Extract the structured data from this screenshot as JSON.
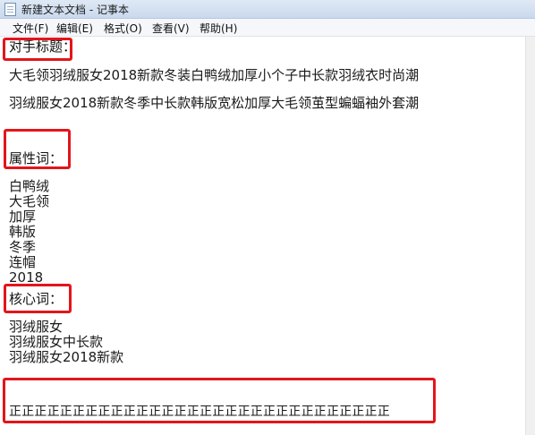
{
  "window": {
    "title": "新建文本文档 - 记事本"
  },
  "menu": {
    "items": [
      "文件(F)",
      "编辑(E)",
      "格式(O)",
      "查看(V)",
      "帮助(H)"
    ]
  },
  "document": {
    "opponent_heading": "对手标题：",
    "opponent_titles": [
      "大毛领羽绒服女2018新款冬装白鸭绒加厚小个子中长款羽绒衣时尚潮",
      "羽绒服女2018新款冬季中长款韩版宽松加厚大毛领茧型蝙蝠袖外套潮"
    ],
    "attribute_heading": "属性词：",
    "attribute_words": [
      "白鸭绒",
      "大毛领",
      "加厚",
      "韩版",
      "冬季",
      "连帽",
      "2018"
    ],
    "core_heading": "核心词：",
    "core_words": [
      "羽绒服女",
      "羽绒服女中长款",
      "羽绒服女2018新款"
    ],
    "bottom_line": "正正正正正正正正正正正正正正正正正正正正正正正正正正正正正正"
  },
  "colors": {
    "highlight_border": "#e3151a",
    "titlebar": "#dfe9f5"
  }
}
